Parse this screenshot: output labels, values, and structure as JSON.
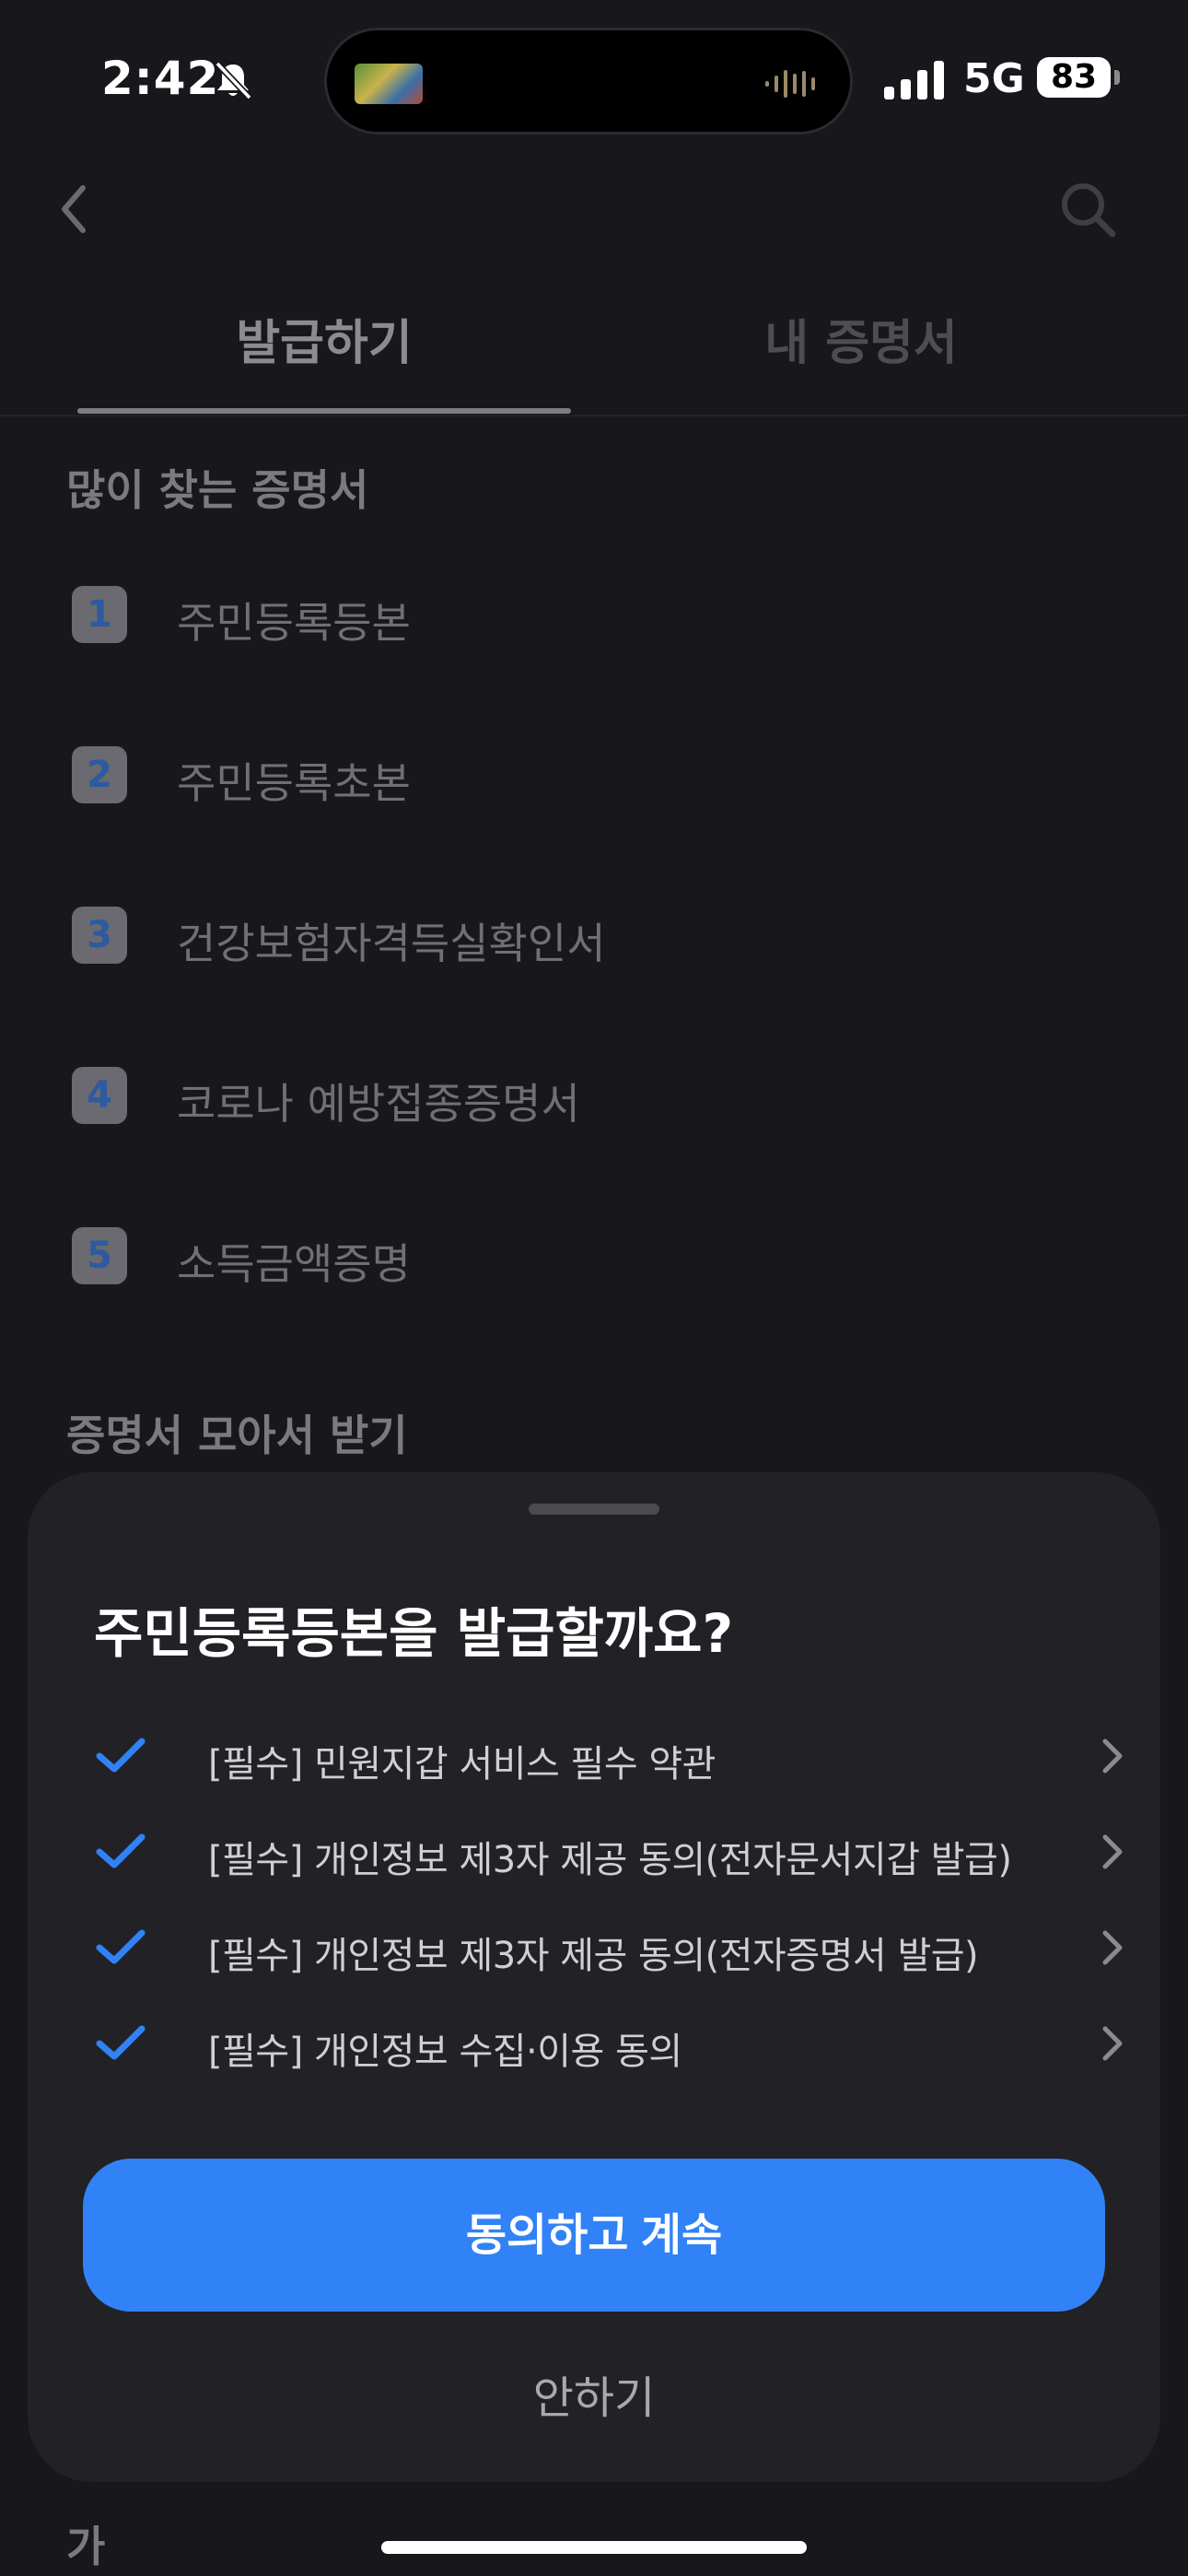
{
  "status_bar": {
    "time": "2:42",
    "network": "5G",
    "battery": "83"
  },
  "tabs": [
    {
      "label": "발급하기",
      "selected": true
    },
    {
      "label": "내 증명서",
      "selected": false
    }
  ],
  "popular": {
    "title": "많이 찾는 증명서",
    "items": [
      {
        "rank": "1",
        "label": "주민등록등본"
      },
      {
        "rank": "2",
        "label": "주민등록초본"
      },
      {
        "rank": "3",
        "label": "건강보험자격득실확인서"
      },
      {
        "rank": "4",
        "label": "코로나 예방접종증명서"
      },
      {
        "rank": "5",
        "label": "소득금액증명"
      }
    ]
  },
  "bundle_section_title": "증명서 모아서 받기",
  "peek_text": "가",
  "sheet": {
    "title": "주민등록등본을 발급할까요?",
    "consents": [
      {
        "label": "[필수] 민원지갑 서비스 필수 약관",
        "checked": true
      },
      {
        "label": "[필수] 개인정보 제3자 제공 동의(전자문서지갑 발급)",
        "checked": true
      },
      {
        "label": "[필수] 개인정보 제3자 제공 동의(전자증명서 발급)",
        "checked": true
      },
      {
        "label": "[필수] 개인정보 수집·이용 동의",
        "checked": true
      }
    ],
    "agree_button": "동의하고 계속",
    "decline_button": "안하기"
  },
  "colors": {
    "accent": "#3182f6",
    "sheet_bg": "#212126",
    "screen_bg": "#17171c"
  }
}
